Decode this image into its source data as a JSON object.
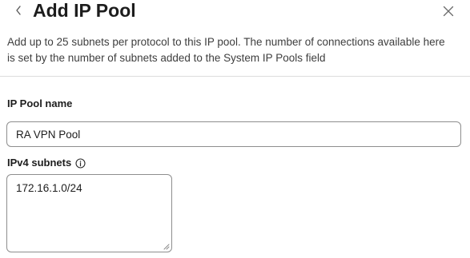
{
  "header": {
    "title": "Add IP Pool",
    "back_icon": "chevron-left-icon",
    "close_icon": "close-icon"
  },
  "description": "Add up to 25 subnets per protocol to this IP pool. The number of connections available here is set by the number of subnets added to the System IP Pools field",
  "form": {
    "pool_name": {
      "label": "IP Pool name",
      "value": "RA VPN Pool"
    },
    "ipv4_subnets": {
      "label": "IPv4 subnets",
      "info_icon": "info-icon",
      "value": "172.16.1.0/24"
    }
  },
  "colors": {
    "title": "#1d1d1d",
    "border": "#8e8e8e",
    "divider": "#dcdcdc"
  }
}
